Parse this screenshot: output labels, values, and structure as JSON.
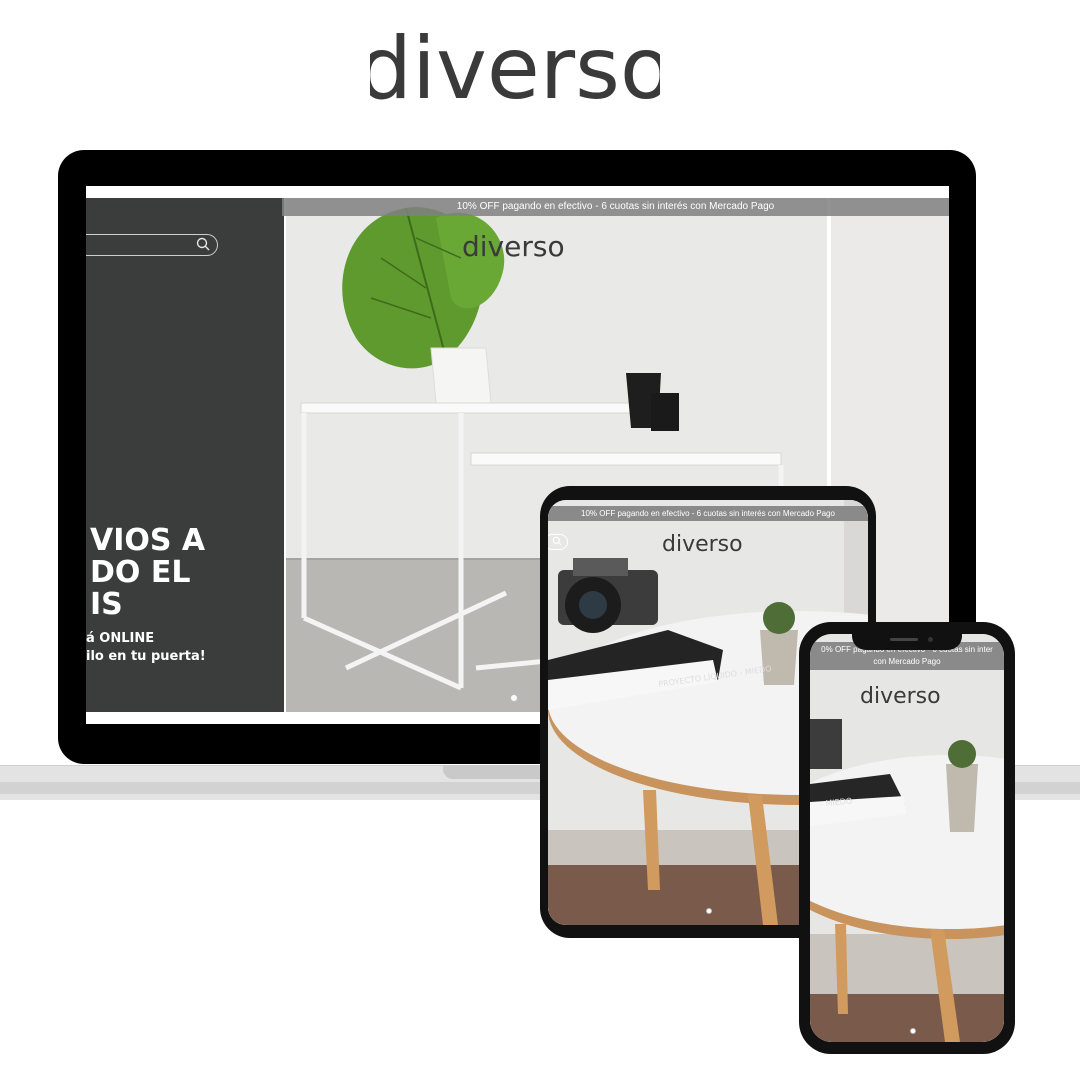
{
  "brand": {
    "logo_text": "diverso"
  },
  "desktop": {
    "promo_text": "10% OFF pagando en efectivo - 6 cuotas sin interés con Mercado Pago",
    "logo_text": "diverso",
    "hero_lines": [
      "VIOS A",
      "DO EL",
      "IS"
    ],
    "hero_sub_1": "á ONLINE",
    "hero_sub_2": "ilo en tu puerta!"
  },
  "tablet": {
    "promo_text": "10% OFF pagando en efectivo - 6 cuotas sin interés con Mercado Pago",
    "logo_text": "diverso",
    "book_top": "",
    "book_spine": "PROYECTO LÍQUIDO - MIEDO"
  },
  "phone": {
    "promo_text_1": "0% OFF pagando en efectivo - 6 cuotas sin inter",
    "promo_text_2": "con Mercado Pago",
    "logo_text": "diverso",
    "book_spine": "- MIEDO"
  },
  "colors": {
    "accent": "#3a3a3a",
    "promo_bg": "#8a8a8a",
    "dark_panel": "#3b3d3d",
    "wall": "#e8e8e6"
  }
}
